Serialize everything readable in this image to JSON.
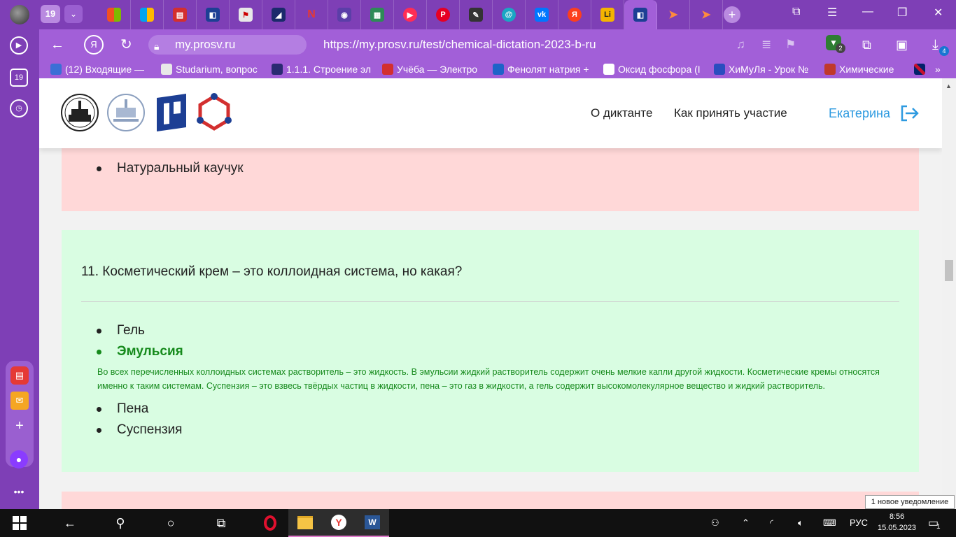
{
  "browser": {
    "tab_count": "19",
    "host": "my.prosv.ru",
    "url": "https://my.prosv.ru/test/chemical-dictation-2023-b-ru",
    "download_badge": "4",
    "shield_badge": "2",
    "sidebar_badge": "19"
  },
  "bookmarks": [
    {
      "label": "(12) Входящие — ",
      "icon_color": "#3b6fd6"
    },
    {
      "label": "Studarium, вопрос",
      "icon_color": "#e8e8e8"
    },
    {
      "label": "1.1.1. Строение эл",
      "icon_color": "#2a2a72"
    },
    {
      "label": "Учёба — Электро",
      "icon_color": "#d32f2f"
    },
    {
      "label": "Фенолят натрия +",
      "icon_color": "#1e63c8"
    },
    {
      "label": "Оксид фосфора (I",
      "icon_color": "#ffffff"
    },
    {
      "label": "ХиМуЛя - Урок №",
      "icon_color": "#2a4dbf"
    },
    {
      "label": "Химические",
      "icon_color": "#c0392b"
    }
  ],
  "site": {
    "nav": [
      "О диктанте",
      "Как принять участие"
    ],
    "user": "Екатерина"
  },
  "prev_question": {
    "options": [
      "Натуральный каучук"
    ]
  },
  "question": {
    "text": "11. Косметический крем – это коллоидная система, но какая?",
    "options": [
      "Гель",
      "Эмульсия",
      "Пена",
      "Суспензия"
    ],
    "correct": "Эмульсия",
    "explanation": "Во всех перечисленных коллоидных системах растворитель – это жидкость. В эмульсии жидкий растворитель содержит очень мелкие капли другой жидкости. Косметические кремы относятся именно к таким системам. Суспензия – это взвесь твёрдых частиц в жидкости, пена – это газ в жидкости, а гель содержит высокомолекулярное вещество и жидкий растворитель."
  },
  "notification": "1 новое уведомление",
  "taskbar": {
    "lang": "РУС",
    "time": "8:56",
    "date": "15.05.2023",
    "notif_count": "1"
  }
}
